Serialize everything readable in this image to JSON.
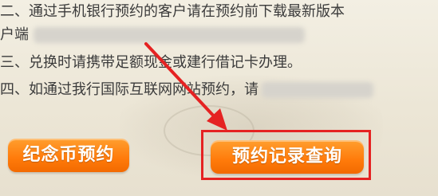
{
  "lines": {
    "line1": "二、通过手机银行预约的客户请在预约前下载最新版本",
    "line2": "户端",
    "line3": "三、兑换时请携带足额现金或建行借记卡办理。",
    "line4": "四、如通过我行国际互联网网站预约，请"
  },
  "buttons": {
    "commemorative": "纪念币预约",
    "records": "预约记录查询"
  },
  "colors": {
    "button_orange": "#ff7a0a",
    "annotation_red": "#e52222"
  }
}
